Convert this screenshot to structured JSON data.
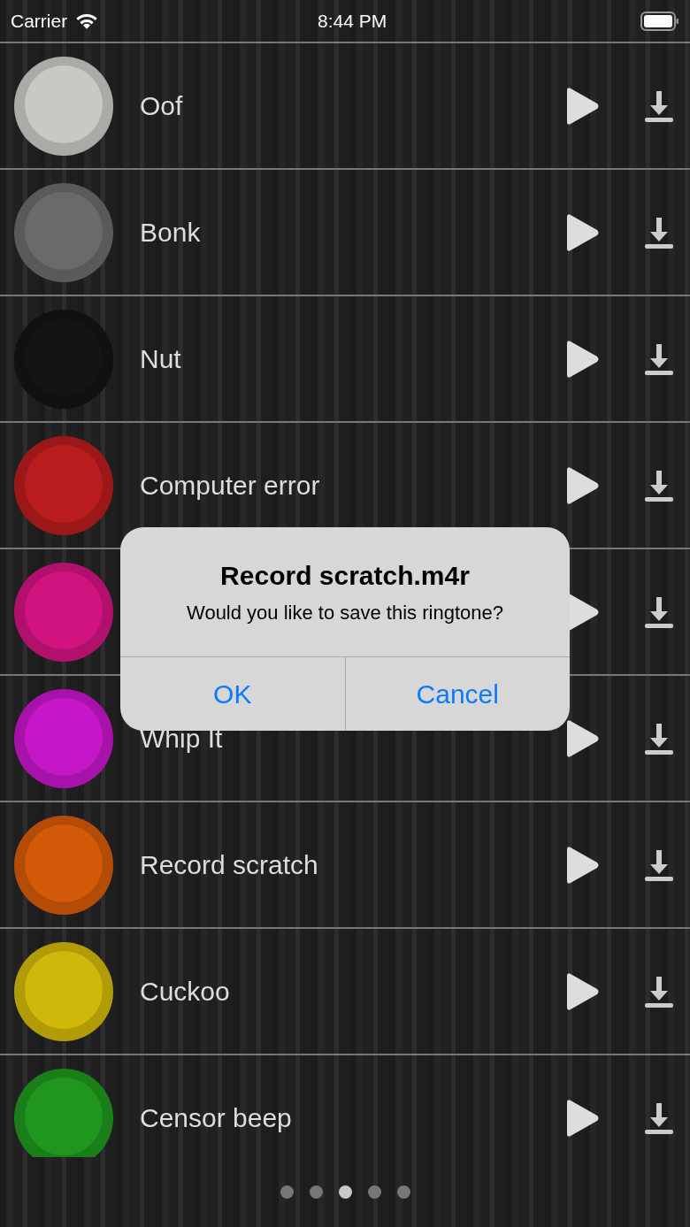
{
  "status_bar": {
    "carrier": "Carrier",
    "time": "8:44 PM"
  },
  "sounds": [
    {
      "name": "Oof",
      "color": "#c8c8c4"
    },
    {
      "name": "Bonk",
      "color": "#6a6a6a"
    },
    {
      "name": "Nut",
      "color": "#141414"
    },
    {
      "name": "Computer error",
      "color": "#b81c1c"
    },
    {
      "color": "#d0137f"
    },
    {
      "name": "Whip It",
      "color": "#c516c8"
    },
    {
      "name": "Record scratch",
      "color": "#d45a0a"
    },
    {
      "name": "Cuckoo",
      "color": "#d0b80a"
    },
    {
      "name": "Censor beep",
      "color": "#20961e"
    }
  ],
  "alert": {
    "title": "Record scratch.m4r",
    "message": "Would you like to save this ringtone?",
    "buttons": [
      "OK",
      "Cancel"
    ]
  },
  "pages": [
    {
      "selected": false
    },
    {
      "selected": false
    },
    {
      "selected": true
    },
    {
      "selected": false
    },
    {
      "selected": false
    }
  ]
}
